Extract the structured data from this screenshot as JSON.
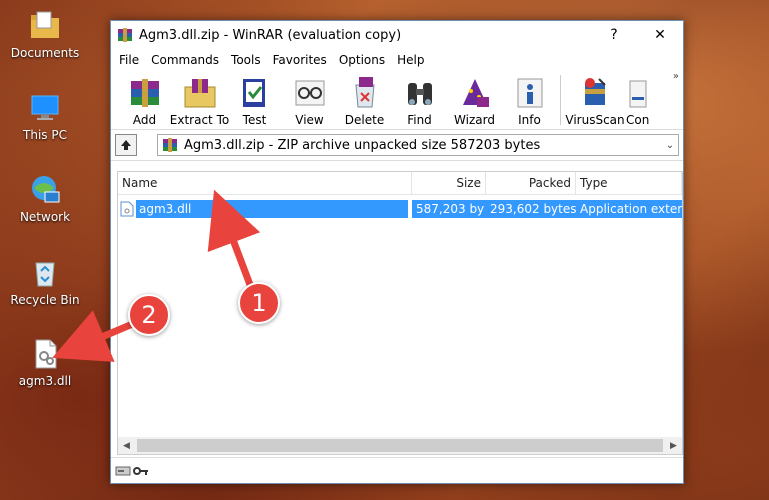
{
  "desktop": {
    "icons": [
      {
        "label": "Documents"
      },
      {
        "label": "This PC"
      },
      {
        "label": "Network"
      },
      {
        "label": "Recycle Bin"
      },
      {
        "label": "agm3.dll"
      }
    ]
  },
  "window": {
    "title": "Agm3.dll.zip - WinRAR (evaluation copy)",
    "help_button": "?",
    "close_button": "✕",
    "menu": [
      "File",
      "Commands",
      "Tools",
      "Favorites",
      "Options",
      "Help"
    ],
    "toolbar": [
      {
        "label": "Add",
        "icon": "books-icon"
      },
      {
        "label": "Extract To",
        "icon": "extract-folder-icon"
      },
      {
        "label": "Test",
        "icon": "test-book-icon"
      },
      {
        "label": "View",
        "icon": "glasses-icon"
      },
      {
        "label": "Delete",
        "icon": "delete-icon"
      },
      {
        "label": "Find",
        "icon": "binoculars-icon"
      },
      {
        "label": "Wizard",
        "icon": "wizard-icon"
      },
      {
        "label": "Info",
        "icon": "info-icon"
      },
      {
        "label": "VirusScan",
        "icon": "virusscan-icon"
      },
      {
        "label": "Con",
        "icon": "comment-icon"
      }
    ],
    "more_chevron": "»",
    "address": {
      "text": "Agm3.dll.zip - ZIP archive unpacked size 587203 bytes",
      "dropdown": "⌄"
    },
    "columns": [
      "Name",
      "Size",
      "Packed",
      "Type"
    ],
    "files": [
      {
        "name": "agm3.dll",
        "size": "587,203 by",
        "packed": "293,602 bytes",
        "type": "Application exten"
      }
    ]
  },
  "callouts": [
    "1",
    "2"
  ],
  "colors": {
    "selection": "#3399ff",
    "callout": "#e8433c",
    "arrow": "#e8433c"
  }
}
